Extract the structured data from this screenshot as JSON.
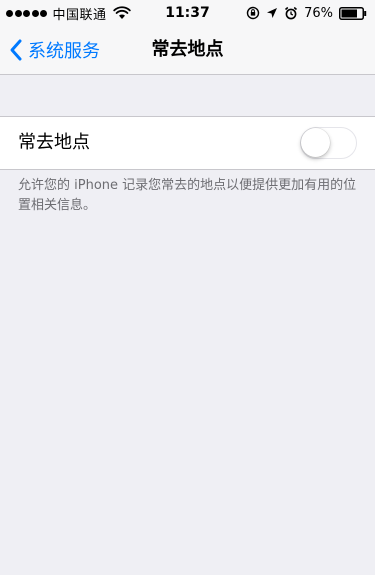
{
  "status_bar": {
    "carrier": "中国联通",
    "time": "11:37",
    "battery": "76%"
  },
  "nav": {
    "back_label": "系统服务",
    "title": "常去地点"
  },
  "setting": {
    "label": "常去地点",
    "toggle_on": false
  },
  "footer": {
    "note": "允许您的 iPhone 记录您常去的地点以便提供更加有用的位置相关信息。"
  },
  "colors": {
    "accent": "#007aff",
    "background": "#efeff4"
  }
}
